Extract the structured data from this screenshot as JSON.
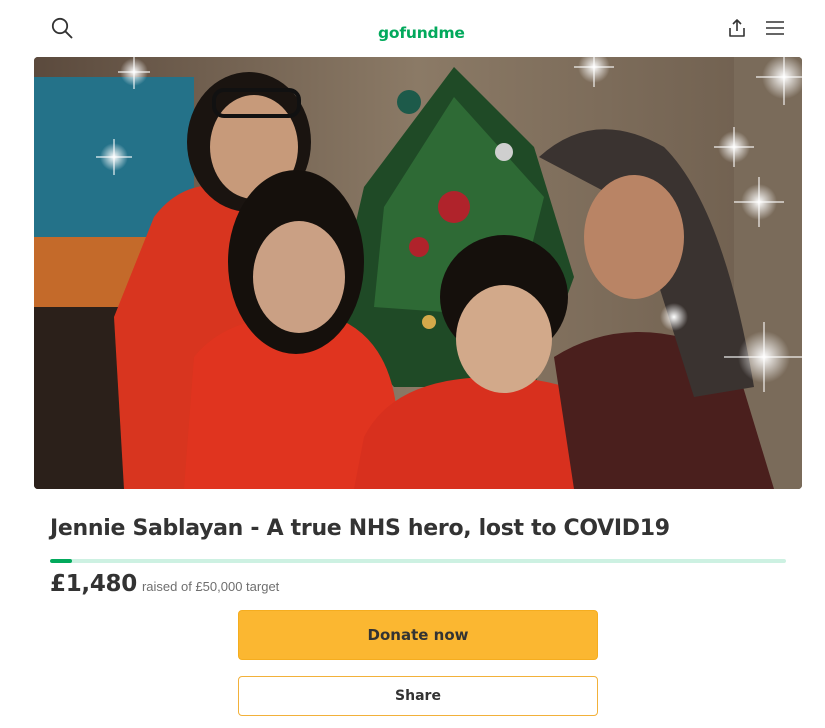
{
  "header": {
    "search_icon": "search-icon",
    "logo_text": "gofundme",
    "share_icon": "share-upload-icon",
    "menu_icon": "hamburger-menu-icon",
    "brand_color": "#02a95c"
  },
  "hero": {
    "image_kind": "family photo in front of a decorated christmas tree"
  },
  "campaign": {
    "title": "Jennie Sablayan - A true NHS hero, lost to COVID19",
    "raised": "£1,480",
    "target_text": "raised of £50,000 target",
    "progress_fraction": 0.0296
  },
  "actions": {
    "donate_label": "Donate now",
    "share_label": "Share",
    "donate_color": "#fbb731"
  }
}
